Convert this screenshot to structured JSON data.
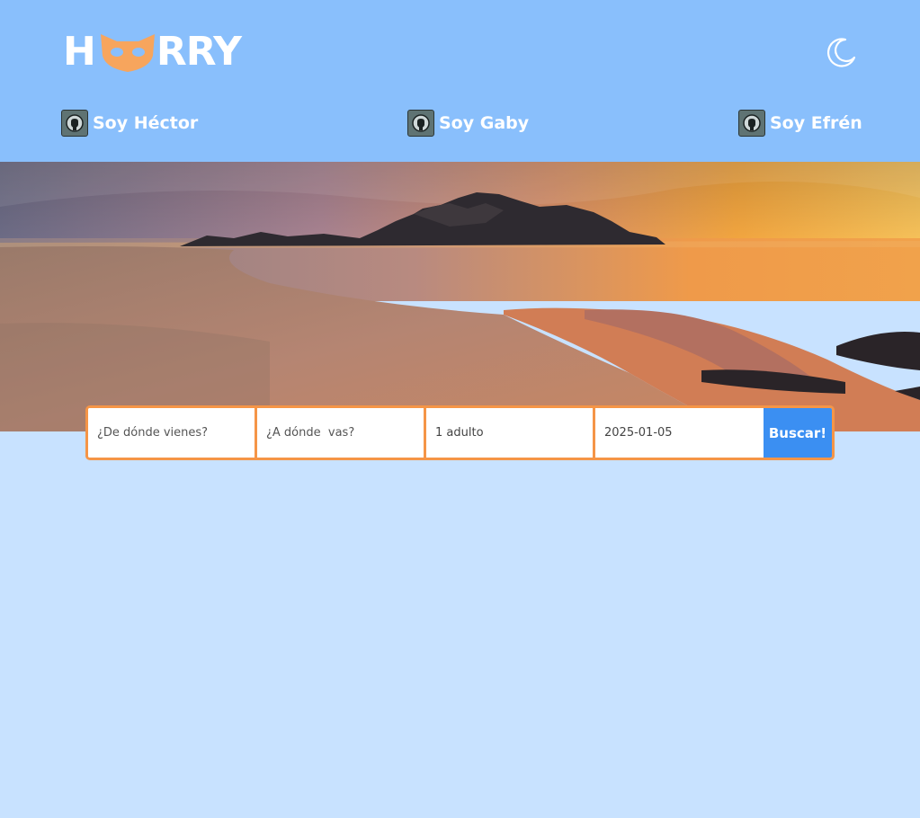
{
  "header": {
    "logo_text_left": "H",
    "logo_text_right": "RRY",
    "links": [
      {
        "label": "Soy Héctor",
        "icon": "github-icon"
      },
      {
        "label": "Soy Gaby",
        "icon": "github-icon"
      },
      {
        "label": "Soy Efrén",
        "icon": "github-icon"
      }
    ],
    "theme_toggle_icon": "moon-icon"
  },
  "search": {
    "origin_placeholder": "¿De dónde vienes?",
    "destination_placeholder": "¿A dónde  vas?",
    "passengers_value": "1 adulto",
    "date_value": "2025-01-05",
    "submit_label": "Buscar!"
  },
  "colors": {
    "header_bg": "#89bffc",
    "page_bg": "#c8e2ff",
    "accent_orange": "#f59547",
    "button_blue": "#3b8ff2"
  }
}
